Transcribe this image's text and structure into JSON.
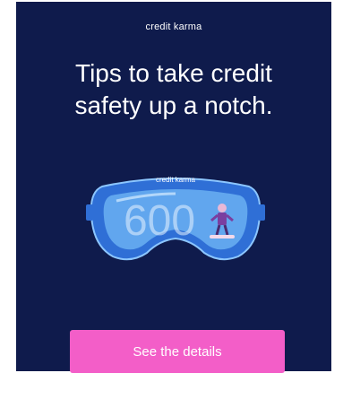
{
  "ad": {
    "brand": "credit karma",
    "headline_line1": "Tips to take credit",
    "headline_line2": "safety up a notch.",
    "goggle_brand": "credit karma",
    "goggle_number": "600",
    "cta_label": "See the details"
  },
  "colors": {
    "background": "#0f1b4c",
    "cta": "#f35ec8",
    "goggle_frame": "#2f6fd6",
    "goggle_lens": "#6ab0f2"
  },
  "icons": [
    "ski-goggles-icon",
    "snowboarder-icon"
  ]
}
